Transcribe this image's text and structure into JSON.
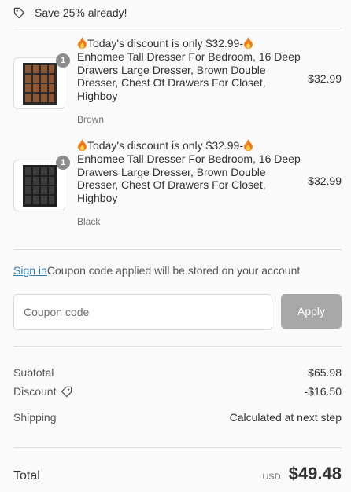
{
  "savings": {
    "text": "Save 25% already!"
  },
  "products": [
    {
      "title": "Today's discount is only $32.99-",
      "name": "Enhomee Tall Dresser For Bedroom, 16 Deep Drawers Large Dresser, Brown Double Dresser, Chest Of Drawers For Closet, Highboy",
      "variant": "Brown",
      "price": "$32.99",
      "quantity": "1",
      "color": "#7a4a2c"
    },
    {
      "title": "Today's discount is only $32.99-",
      "name": "Enhomee Tall Dresser For Bedroom, 16 Deep Drawers Large Dresser, Brown Double Dresser, Chest Of Drawers For Closet, Highboy",
      "variant": "Black",
      "price": "$32.99",
      "quantity": "1",
      "color": "#2e2e2e"
    }
  ],
  "signin": {
    "link": "Sign in",
    "text": "Coupon code applied will be stored on your account"
  },
  "coupon": {
    "placeholder": "Coupon code",
    "apply_label": "Apply"
  },
  "summary": {
    "subtotal_label": "Subtotal",
    "subtotal_value": "$65.98",
    "discount_label": "Discount",
    "discount_value": "-$16.50",
    "shipping_label": "Shipping",
    "shipping_value": "Calculated at next step",
    "total_label": "Total",
    "currency": "USD",
    "total_value": "$49.48"
  },
  "colors": {
    "link": "#2f7fb6",
    "apply_button": "#a8a8a8"
  }
}
